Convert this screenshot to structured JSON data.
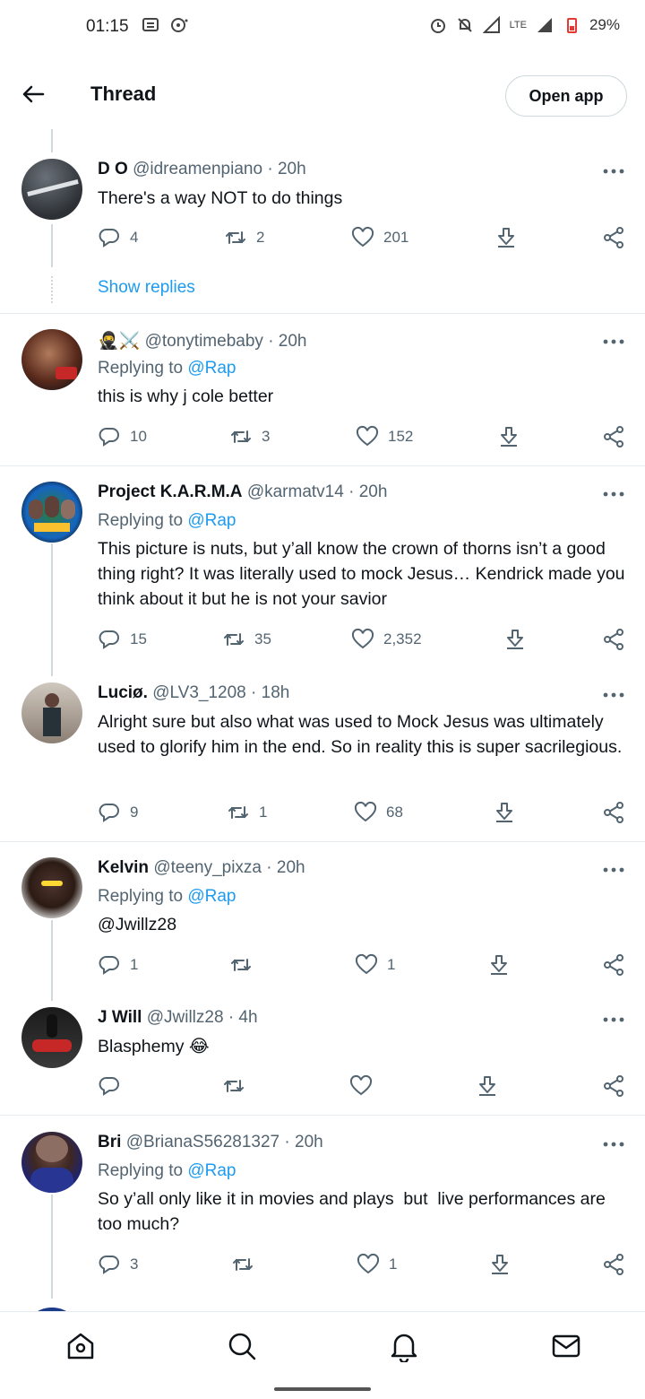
{
  "status_bar": {
    "time": "01:15",
    "battery": "29%",
    "network": "LTE",
    "icons": [
      "message-icon",
      "chat-icon",
      "alarm-icon",
      "mute-icon",
      "signal-icon",
      "signal-icon",
      "battery-icon"
    ]
  },
  "header": {
    "title": "Thread",
    "open_app_label": "Open app"
  },
  "tweets": [
    {
      "name": "D O",
      "handle": "@idreamenpiano",
      "time": "· 20h",
      "replying_to": "",
      "text": "There's a way NOT to do things",
      "replies": "4",
      "retweets": "2",
      "likes": "201",
      "show_replies": "Show replies"
    },
    {
      "name": "🥷⚔️",
      "handle": "@tonytimebaby",
      "time": "· 20h",
      "replying_label": "Replying to",
      "replying_to": "@Rap",
      "text": "this is why j cole better",
      "replies": "10",
      "retweets": "3",
      "likes": "152"
    },
    {
      "name": "Project K.A.R.M.A",
      "handle": "@karmatv14",
      "time": "· 20h",
      "replying_label": "Replying to",
      "replying_to": "@Rap",
      "text": "This picture is nuts, but y’all know the crown of thorns isn’t a good thing right? It was literally used to mock Jesus… Kendrick made you think about it but he is not your savior",
      "replies": "15",
      "retweets": "35",
      "likes": "2,352"
    },
    {
      "name": "Luciø.",
      "handle": "@LV3_1208",
      "time": "· 18h",
      "text": "Alright sure but also what was used to Mock Jesus was ultimately used to glorify him in the end. So in reality this is super sacrilegious.",
      "replies": "9",
      "retweets": "1",
      "likes": "68"
    },
    {
      "name": "Kelvin",
      "handle": "@teeny_pixza",
      "time": "· 20h",
      "replying_label": "Replying to",
      "replying_to": "@Rap",
      "text": "@Jwillz28",
      "replies": "1",
      "retweets": "",
      "likes": "1"
    },
    {
      "name": "J Will",
      "handle": "@Jwillz28",
      "time": "· 4h",
      "text": "Blasphemy 😂",
      "replies": "",
      "retweets": "",
      "likes": ""
    },
    {
      "name": "Bri",
      "handle": "@BrianaS56281327",
      "time": "· 20h",
      "replying_label": "Replying to",
      "replying_to": "@Rap",
      "text": "So y’all only like it in movies and plays  but  live performances are too much?",
      "replies": "3",
      "retweets": "",
      "likes": "1"
    }
  ],
  "bottom_nav": [
    "home-icon",
    "search-icon",
    "notifications-icon",
    "messages-icon"
  ]
}
